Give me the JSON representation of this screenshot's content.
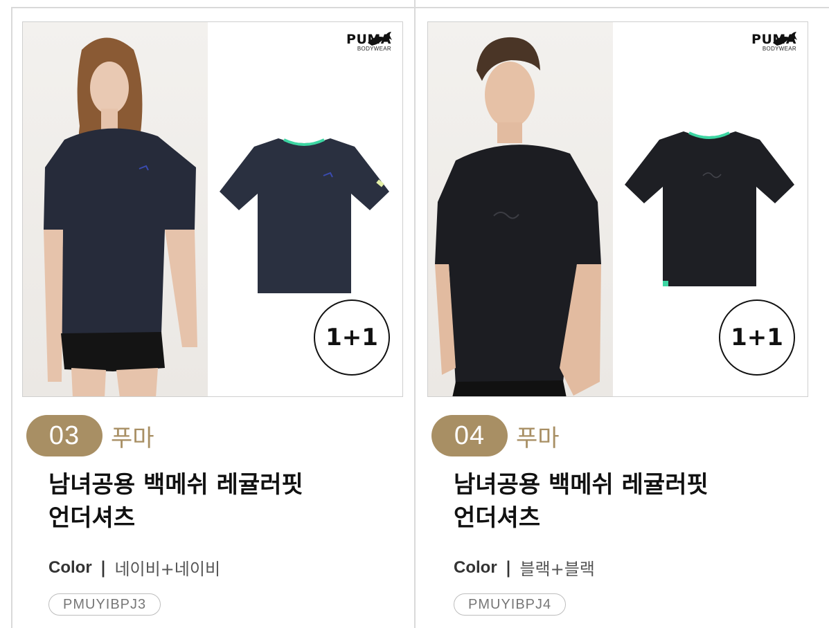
{
  "products": [
    {
      "index": "03",
      "brand": "푸마",
      "title_line1": "남녀공용 백메쉬 레귤러핏",
      "title_line2": "언더셔츠",
      "color_label": "Color",
      "color_separator": "|",
      "color_value": "네이비+네이비",
      "code": "PMUYIBPJ3",
      "badge": "1+1",
      "logo_word": "PUMA",
      "logo_sub": "BODYWEAR",
      "shirt_color": "#2a3040",
      "icon": "shirt-icon"
    },
    {
      "index": "04",
      "brand": "푸마",
      "title_line1": "남녀공용 백메쉬 레귤러핏",
      "title_line2": "언더셔츠",
      "color_label": "Color",
      "color_separator": "|",
      "color_value": "블랙+블랙",
      "code": "PMUYIBPJ4",
      "badge": "1+1",
      "logo_word": "PUMA",
      "logo_sub": "BODYWEAR",
      "shirt_color": "#1e1f24",
      "icon": "shirt-icon"
    }
  ],
  "colors": {
    "accent": "#a88f64",
    "border": "#d9d9d9"
  }
}
